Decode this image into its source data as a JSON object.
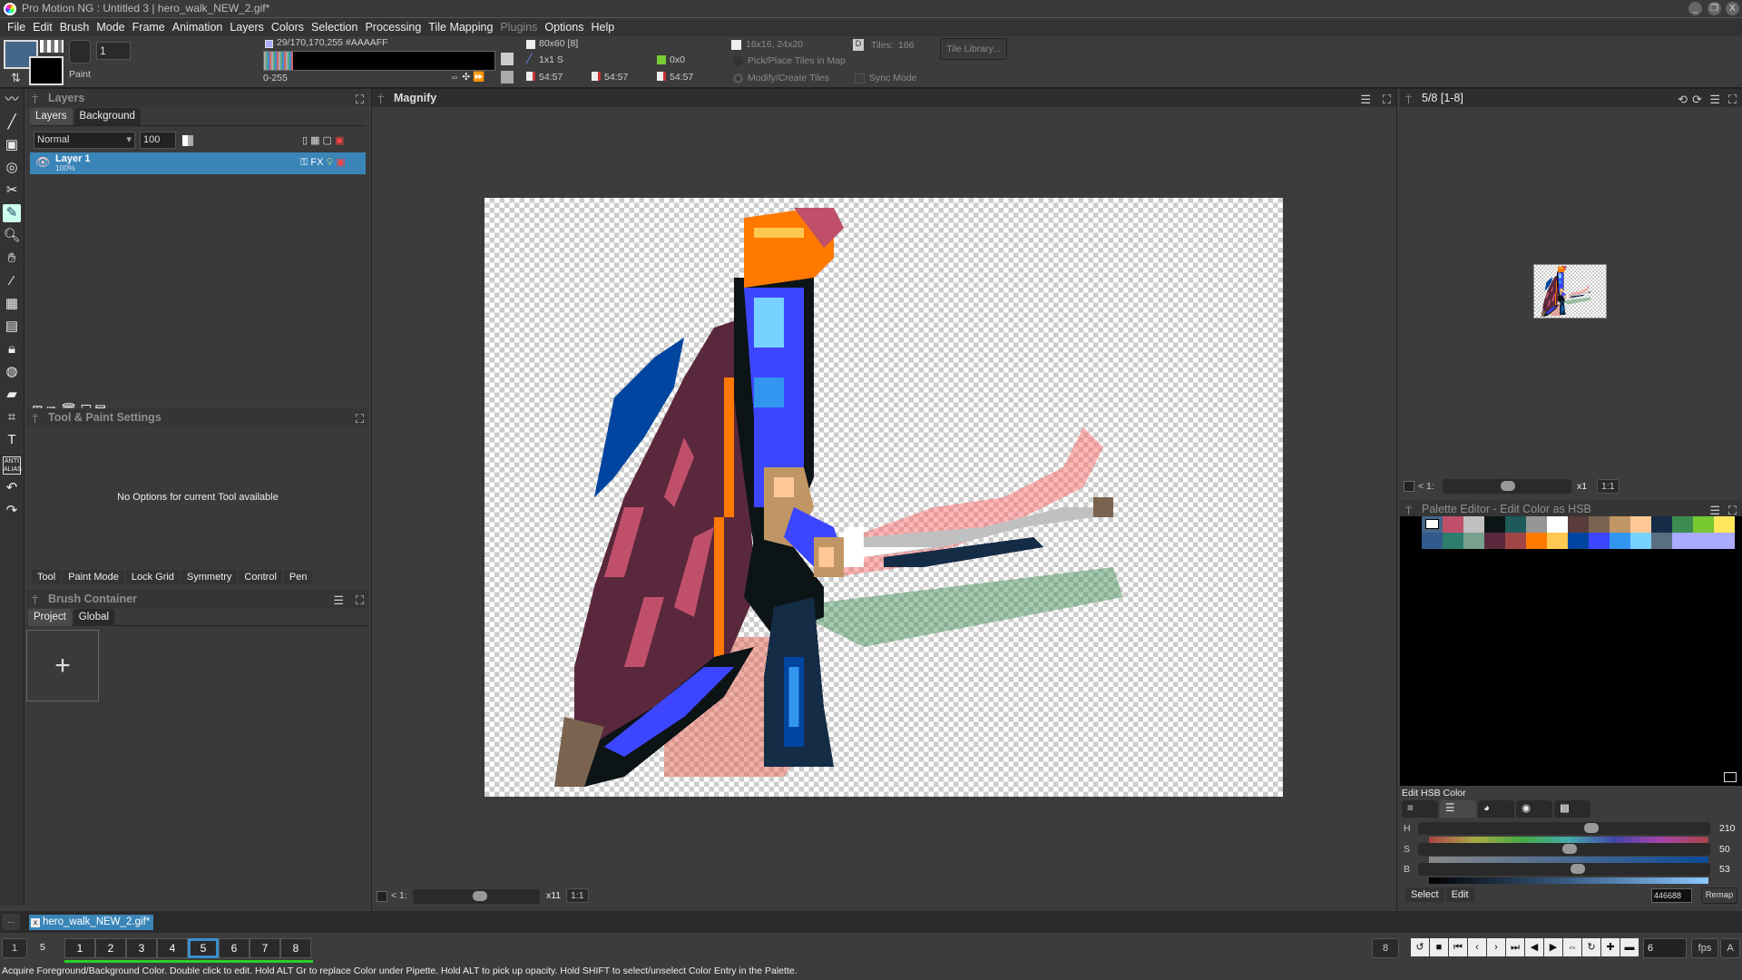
{
  "window": {
    "title": "Pro Motion NG : Untitled 3 | hero_walk_NEW_2.gif*",
    "min": "_",
    "max": "❐",
    "close": "X"
  },
  "menu": [
    "File",
    "Edit",
    "Brush",
    "Mode",
    "Frame",
    "Animation",
    "Layers",
    "Colors",
    "Selection",
    "Processing",
    "Tile Mapping",
    "Plugins",
    "Options",
    "Help"
  ],
  "toolbar": {
    "brush_size": "1",
    "paint_label": "Paint",
    "color_info": "29/170,170,255 #AAAAFF",
    "range": "0-255",
    "canvas_size": "80x60 [8]",
    "brush_info": "1x1 S",
    "offset": "0x0",
    "coord1": "54:57",
    "coord2": "54:57",
    "coord3": "54:57",
    "tile_size": "16x16, 24x20",
    "pick_place": "Pick/Place Tiles in Map",
    "modify_create": "Modify/Create Tiles",
    "tiles_label": "Tiles:",
    "tiles_count": "166",
    "tile_library": "Tile Library...",
    "sync_mode": "Sync Mode",
    "fg_color": "#446688",
    "bg_color": "#000000"
  },
  "layers": {
    "title": "Layers",
    "tabs": [
      "Layers",
      "Background"
    ],
    "blend_mode": "Normal",
    "opacity": "100",
    "items": [
      {
        "name": "Layer 1",
        "opacity": "100%"
      }
    ]
  },
  "tool_settings": {
    "title": "Tool & Paint Settings",
    "message": "No Options for current Tool available",
    "tabs": [
      "Tool",
      "Paint Mode",
      "Lock Grid",
      "Symmetry",
      "Control",
      "Pen"
    ]
  },
  "brush_container": {
    "title": "Brush Container",
    "tabs": [
      "Project",
      "Global"
    ],
    "add": "+"
  },
  "magnify": {
    "title": "Magnify",
    "lt": "< 1:",
    "zoom": "x11",
    "ratio": "1:1",
    "pixel_size": "80x60"
  },
  "preview": {
    "title": "5/8  [1-8]",
    "lt": "< 1:",
    "zoom": "x1",
    "ratio": "1:1"
  },
  "palette": {
    "title": "Palette Editor - Edit Color as HSB",
    "selected": "#446688",
    "row1": [
      "#ffffff",
      "#c0506a",
      "#c0c0c0",
      "#0c1416",
      "#1e5a5a",
      "#969696",
      "#ffffff",
      "#5a3c3c",
      "#7a6450",
      "#c09664",
      "#ffc896",
      "#142c46",
      "#3c8c50",
      "#78c832",
      "#ffe65a"
    ],
    "row2": [
      "#325a8c",
      "#2d7d6e",
      "#78a08c",
      "#5a283c",
      "#a04646",
      "#ff7800",
      "#ffc850",
      "#0046a0",
      "#3c46ff",
      "#3296f0",
      "#78d2ff",
      "#5a6e82",
      "#aaaaff",
      "#aaaaff",
      "#aaaaff"
    ]
  },
  "hsb": {
    "title": "Edit HSB Color",
    "h_label": "H",
    "h": 210,
    "s_label": "S",
    "s": 50,
    "b_label": "B",
    "b": 53,
    "hex": "446688",
    "remap": "Remap",
    "tabs": [
      "Select",
      "Edit"
    ]
  },
  "document_tab": {
    "more": "...",
    "name": "hero_walk_NEW_2.gif*"
  },
  "frames": {
    "first": "1",
    "current": "5",
    "items": [
      "1",
      "2",
      "3",
      "4",
      "5",
      "6",
      "7",
      "8"
    ],
    "current_index": 4,
    "total": "8",
    "fps_value": "6",
    "fps_label": "fps",
    "auto": "A"
  },
  "status": "Acquire Foreground/Background Color. Double click to edit. Hold ALT Gr to replace Color under Pipette. Hold ALT to pick up opacity. Hold SHIFT to select/unselect Color Entry in the Palette."
}
